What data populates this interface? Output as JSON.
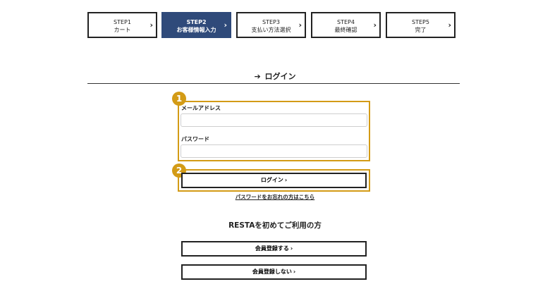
{
  "steps": [
    {
      "num": "STEP1",
      "name": "カート",
      "active": false
    },
    {
      "num": "STEP2",
      "name": "お客様情報入力",
      "active": true
    },
    {
      "num": "STEP3",
      "name": "支払い方法選択",
      "active": false
    },
    {
      "num": "STEP4",
      "name": "最終確認",
      "active": false
    },
    {
      "num": "STEP5",
      "name": "完了",
      "active": false
    }
  ],
  "step_chevron": "›",
  "login": {
    "title_icon": "login-icon",
    "title_icon_glyph": "➔",
    "title": "ログイン",
    "email_label": "メールアドレス",
    "email_value": "",
    "password_label": "パスワード",
    "password_value": "",
    "submit_label": "ログイン",
    "forgot_link": "パスワードをお忘れの方はこちら"
  },
  "annotations": {
    "badge1": "1",
    "badge2": "2",
    "highlight_color": "#d39b16"
  },
  "signup": {
    "heading": "RESTAを初めてご利用の方",
    "register_label": "会員登録する",
    "guest_label": "会員登録しない"
  },
  "button_arrow": "›",
  "colors": {
    "active_step": "#2f4a7a",
    "border": "#222222"
  }
}
